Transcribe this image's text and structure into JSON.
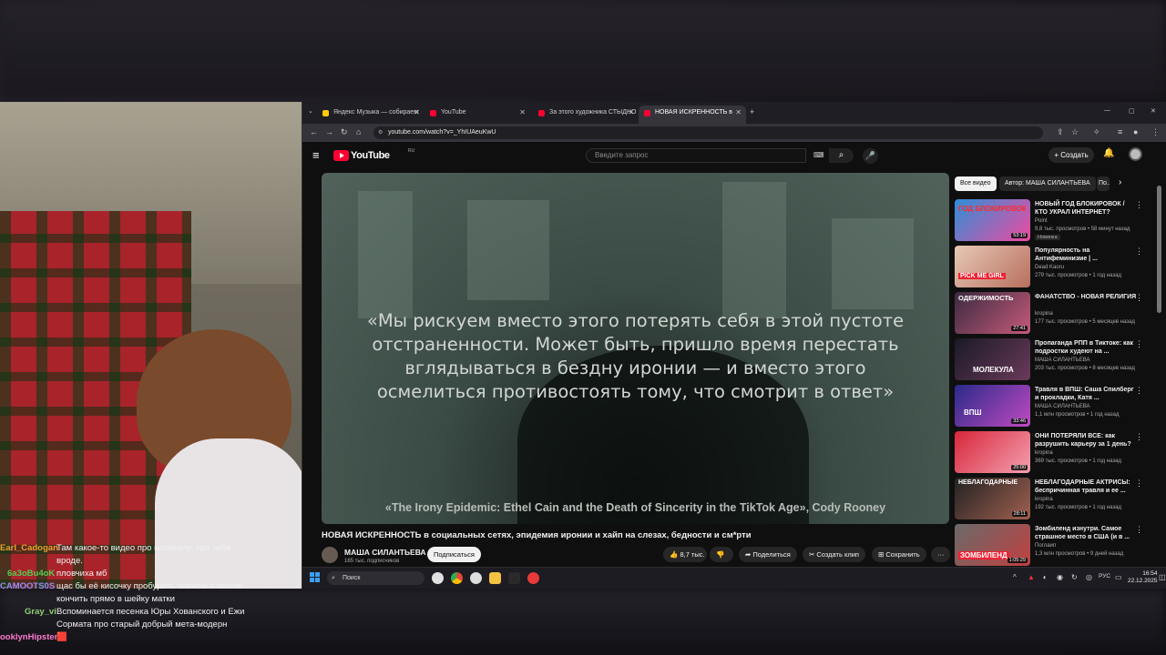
{
  "browser": {
    "tabs": [
      {
        "label": "Яндекс Музыка — собираем ..."
      },
      {
        "label": "YouTube"
      },
      {
        "label": "За этого художника СТЫДНО"
      },
      {
        "label": "НОВАЯ ИСКРЕННОСТЬ в соц..."
      }
    ],
    "url": "youtube.com/watch?v=_YhIUAeuKwU"
  },
  "youtube": {
    "logo_text": "YouTube",
    "logo_region": "RU",
    "search_placeholder": "Введите запрос",
    "create_label": "Создать",
    "player": {
      "quote": "«Мы рискуем вместо этого потерять себя в этой пустоте отстраненности. Может быть, пришло время перестать вглядываться в бездну иронии — и вместо этого осмелиться противостоять тому, что смотрит в ответ»",
      "source": "«The Irony Epidemic: Ethel Cain and the Death of Sincerity in the TikTok Age», Cody Rooney"
    },
    "video_title": "НОВАЯ ИСКРЕННОСТЬ в социальных сетях, эпидемия иронии и хайп на слезах, бедности и см*рти",
    "channel": {
      "name": "МАША СИЛАНТЬЕВА",
      "subscribers": "165 тыс. подписчиков"
    },
    "subscribe_label": "Подписаться",
    "actions": {
      "likes": "8,7 тыс.",
      "share": "Поделиться",
      "clip": "Создать клип",
      "save": "Сохранить"
    },
    "chips": [
      "Все видео",
      "Автор: МАША СИЛАНТЬЕВА",
      "По..."
    ],
    "recommendations": [
      {
        "title": "НОВЫЙ ГОД БЛОКИРОВОК / КТО УКРАЛ ИНТЕРНЕТ?",
        "channel": "Point",
        "meta": "9,8 тыс. просмотров • 58 минут назад",
        "badge": "Новинка",
        "duration": "53:19",
        "thumb_text": "ГОД БЛОКИРОВОК"
      },
      {
        "title": "Популярность на Антифеминизме | ...",
        "channel": "Dead Kaoru",
        "meta": "279 тыс. просмотров • 1 год назад",
        "badge": "",
        "duration": "",
        "thumb_text": "PICK ME GIRL"
      },
      {
        "title": "ФАНАТСТВО - НОВАЯ РЕЛИГИЯ",
        "channel": "kropina",
        "meta": "177 тыс. просмотров • 5 месяцев назад",
        "badge": "",
        "duration": "27:41",
        "thumb_text": "ОДЕРЖИМОСТЬ"
      },
      {
        "title": "Пропаганда РПП в Тиктоке: как подростки худеют на ...",
        "channel": "МАША СИЛАНТЬЕВА",
        "meta": "203 тыс. просмотров • 8 месяцев назад",
        "badge": "",
        "duration": "",
        "thumb_text": "МОЛЕКУЛА"
      },
      {
        "title": "Травля в ВПШ: Саша Спилберг и прокладки, Катя ...",
        "channel": "МАША СИЛАНТЬЕВА",
        "meta": "1,1 млн просмотров • 1 год назад",
        "badge": "",
        "duration": "33:46",
        "thumb_text": "ВПШ"
      },
      {
        "title": "ОНИ ПОТЕРЯЛИ ВСЕ: как разрушить карьеру за 1 день?",
        "channel": "kropina",
        "meta": "369 тыс. просмотров • 1 год назад",
        "badge": "",
        "duration": "25:00",
        "thumb_text": ""
      },
      {
        "title": "НЕБЛАГОДАРНЫЕ АКТРИСЫ: беспричинная травля и ее ...",
        "channel": "kropina",
        "meta": "192 тыс. просмотров • 1 год назад",
        "badge": "",
        "duration": "28:11",
        "thumb_text": "НЕБЛАГОДАРНЫЕ"
      },
      {
        "title": "Зомбиленд изнутри. Самое страшное место в США (и в ...",
        "channel": "Поглаип",
        "meta": "1,3 млн просмотров • 9 дней назад",
        "badge": "",
        "duration": "1:05:29",
        "thumb_text": "ЗОМБИЛЕНД"
      }
    ]
  },
  "taskbar": {
    "search_label": "Поиск",
    "language": "РУС",
    "time": "16:54",
    "date": "22.12.2025"
  },
  "chat": [
    {
      "user": "Earl_Cadogan",
      "color": "#f0a030",
      "text": "Там какое-то видео про молекулу, про тебя"
    },
    {
      "user": "",
      "color": "#ffffff",
      "text": "вроде."
    },
    {
      "user": "6a3oBu4oK",
      "color": "#4fd04f",
      "text": "пловчиха мб"
    },
    {
      "user": "CAMOOTS0S",
      "color": "#9b8cff",
      "text": "щас бы её кисочку пробурить членом а потом"
    },
    {
      "user": "",
      "color": "#ffffff",
      "text": "кончить прямо в шейку матки"
    },
    {
      "user": "Gray_vi",
      "color": "#8fd06f",
      "text": "Вспоминается песенка Юры Хованского и Ежи"
    },
    {
      "user": "",
      "color": "#ffffff",
      "text": "Сормата про старый добрый мета-модерн"
    },
    {
      "user": "ooklynHipster",
      "color": "#ff7ad0",
      "text": "🟥"
    }
  ]
}
